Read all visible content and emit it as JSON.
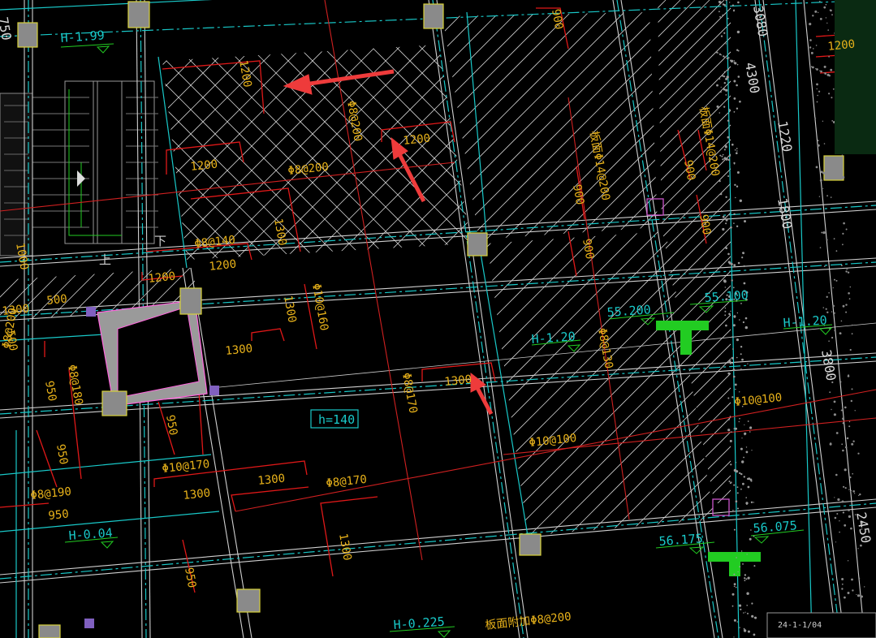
{
  "drawing": {
    "levels": {
      "h_199": "H-1.99",
      "h_120_center": "H-1.20",
      "h_120_right": "H-1.20",
      "h_004": "H-0.04",
      "h_0225": "H-0.225",
      "slab_h140": "h=140"
    },
    "elevations": {
      "e55200": "55.200",
      "e55100": "55.100",
      "e56175": "56.175",
      "e56075": "56.075"
    },
    "rebar": {
      "r1": "Φ8@200",
      "r2": "Φ8@200",
      "r3": "Φ8@140",
      "r4": "Φ10@160",
      "r5": "Φ8@200",
      "r6": "Φ8@180",
      "r7": "Φ10@170",
      "r8": "Φ8@190",
      "r9": "Φ8@170",
      "r10": "Φ8@170",
      "r11": "Φ8@130",
      "r12": "Φ10@100",
      "r13": "Φ10@100",
      "r14": "板面附加Φ8@200",
      "r15": "板面Φ14@200",
      "r16": "板面Φ14@200"
    },
    "dims": {
      "d1200a": "1200",
      "d1200b": "1200",
      "d1200c": "1200",
      "d1200d": "1200",
      "d1200e": "1200",
      "d1200f": "1200",
      "d1300a": "1300",
      "d1300b": "1300",
      "d1300c": "1300",
      "d1300d": "1300",
      "d1300e": "1300",
      "d1300f": "1300",
      "d1300g": "1300",
      "d1300h": "1300",
      "d900a": "900",
      "d900b": "900",
      "d900c": "900",
      "d900d": "900",
      "d900e": "900",
      "d950a": "950",
      "d950b": "950",
      "d950c": "950",
      "d950d": "950",
      "d500a": "500",
      "d500b": "500",
      "d1000": "1000"
    },
    "axis_dims": {
      "a3080": "3080",
      "a4300": "4300",
      "a1220": "1220",
      "a1800": "1800",
      "a3800": "3800",
      "a2450": "2450",
      "a750": "750"
    },
    "stair_marks": {
      "up": "上",
      "down": "下"
    },
    "title_block": "24-1-1/04",
    "colors": {
      "axis": "#19c9c9",
      "dimension_line": "#e01818",
      "text": "#e8b21a",
      "hatch": "#cfcfcf",
      "arrow": "#ee3b3b",
      "beam": "#d8d8d8",
      "column": "#8a8a8a",
      "embed": "#22cc22"
    }
  }
}
